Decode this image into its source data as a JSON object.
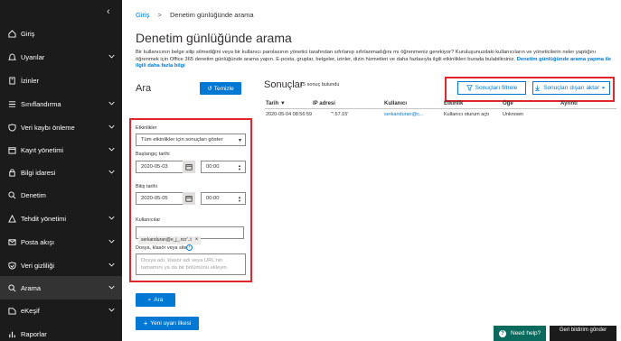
{
  "sidebar": {
    "items": [
      {
        "label": "Giriş",
        "icon": "home-icon",
        "has_chevron": false
      },
      {
        "label": "Uyarılar",
        "icon": "alert-icon",
        "has_chevron": true
      },
      {
        "label": "İzinler",
        "icon": "permissions-icon",
        "has_chevron": false
      },
      {
        "label": "Sınıflandırma",
        "icon": "classification-icon",
        "has_chevron": true
      },
      {
        "label": "Veri kaybı önleme",
        "icon": "shield-icon",
        "has_chevron": true
      },
      {
        "label": "Kayıt yönetimi",
        "icon": "records-icon",
        "has_chevron": true
      },
      {
        "label": "Bilgi idaresi",
        "icon": "lock-icon",
        "has_chevron": true
      },
      {
        "label": "Denetim",
        "icon": "audit-icon",
        "has_chevron": false
      },
      {
        "label": "Tehdit yönetimi",
        "icon": "threat-icon",
        "has_chevron": true
      },
      {
        "label": "Posta akışı",
        "icon": "mail-icon",
        "has_chevron": true
      },
      {
        "label": "Veri gizliliği",
        "icon": "privacy-icon",
        "has_chevron": true
      },
      {
        "label": "Arama",
        "icon": "search-icon",
        "has_chevron": true
      },
      {
        "label": "eKeşif",
        "icon": "ediscovery-icon",
        "has_chevron": true
      },
      {
        "label": "Raporlar",
        "icon": "reports-icon",
        "has_chevron": false
      }
    ]
  },
  "breadcrumb": {
    "root": "Giriş",
    "separator": ">",
    "current": "Denetim günlüğünde arama"
  },
  "page": {
    "title": "Denetim günlüğünde arama",
    "description": "Bir kullanıcının belge silip silmediğini veya bir kullanıcı parolasının yönetici tarafından sıfırlanıp sıfırlanmadığını mı öğrenmeniz gerekiyor? Kuruluşunuzdaki kullanıcıların ve yöneticilerin neler yaptığını öğrenmek için Office 365 denetim günlüğünde arama yapın. E-posta, gruplar, belgeler, izinler, dizin hizmetleri ve daha fazlasıyla ilgili etkinlikleri burada bulabilirsiniz.",
    "description_link": "Denetim günlüğünde arama yapma ile ilgili daha fazla bilgi"
  },
  "search_panel": {
    "title": "Ara",
    "clear_button": "Temizle",
    "activities_label": "Etkinlikler",
    "activities_value": "Tüm etkinlikler için sonuçları göster",
    "start_date_label": "Başlangıç tarihi",
    "start_date": "2020-05-03",
    "start_time": "00:00",
    "end_date_label": "Bitiş tarihi",
    "end_date": "2020-05-05",
    "end_time": "00:00",
    "users_label": "Kullanıcılar",
    "user_chip": "serkanduran@e_j_.ncr'..t",
    "file_label": "Dosya, klasör veya site",
    "file_placeholder": "Dosya adı, klasör adı veya URL'nin tamamını ya da bir bölümünü ekleyin.",
    "search_button": "Ara",
    "new_policy_button": "Yeni uyarı ilkesi"
  },
  "results": {
    "title": "Sonuçlar",
    "count": "15 sonuç bulundu",
    "filter_button": "Sonuçları filtrele",
    "export_button": "Sonuçları dışarı aktar",
    "columns": [
      "Tarih",
      "IP adresi",
      "Kullanıcı",
      "Etkinlik",
      "Öğe",
      "Ayrıntı"
    ],
    "rows": [
      {
        "date": "2020-05-04 08:56:59",
        "ip": "\"'.57.15'",
        "user": "serkanduran@c...",
        "activity": "Kullanıcı oturum açtı",
        "item": "Unknown",
        "detail": ""
      }
    ]
  },
  "footer": {
    "help": "Need help?",
    "feedback": "Geri bildirim gönder"
  },
  "colors": {
    "accent": "#0078d4",
    "highlight": "#e0262b",
    "sidebar": "#1b1b1b"
  }
}
